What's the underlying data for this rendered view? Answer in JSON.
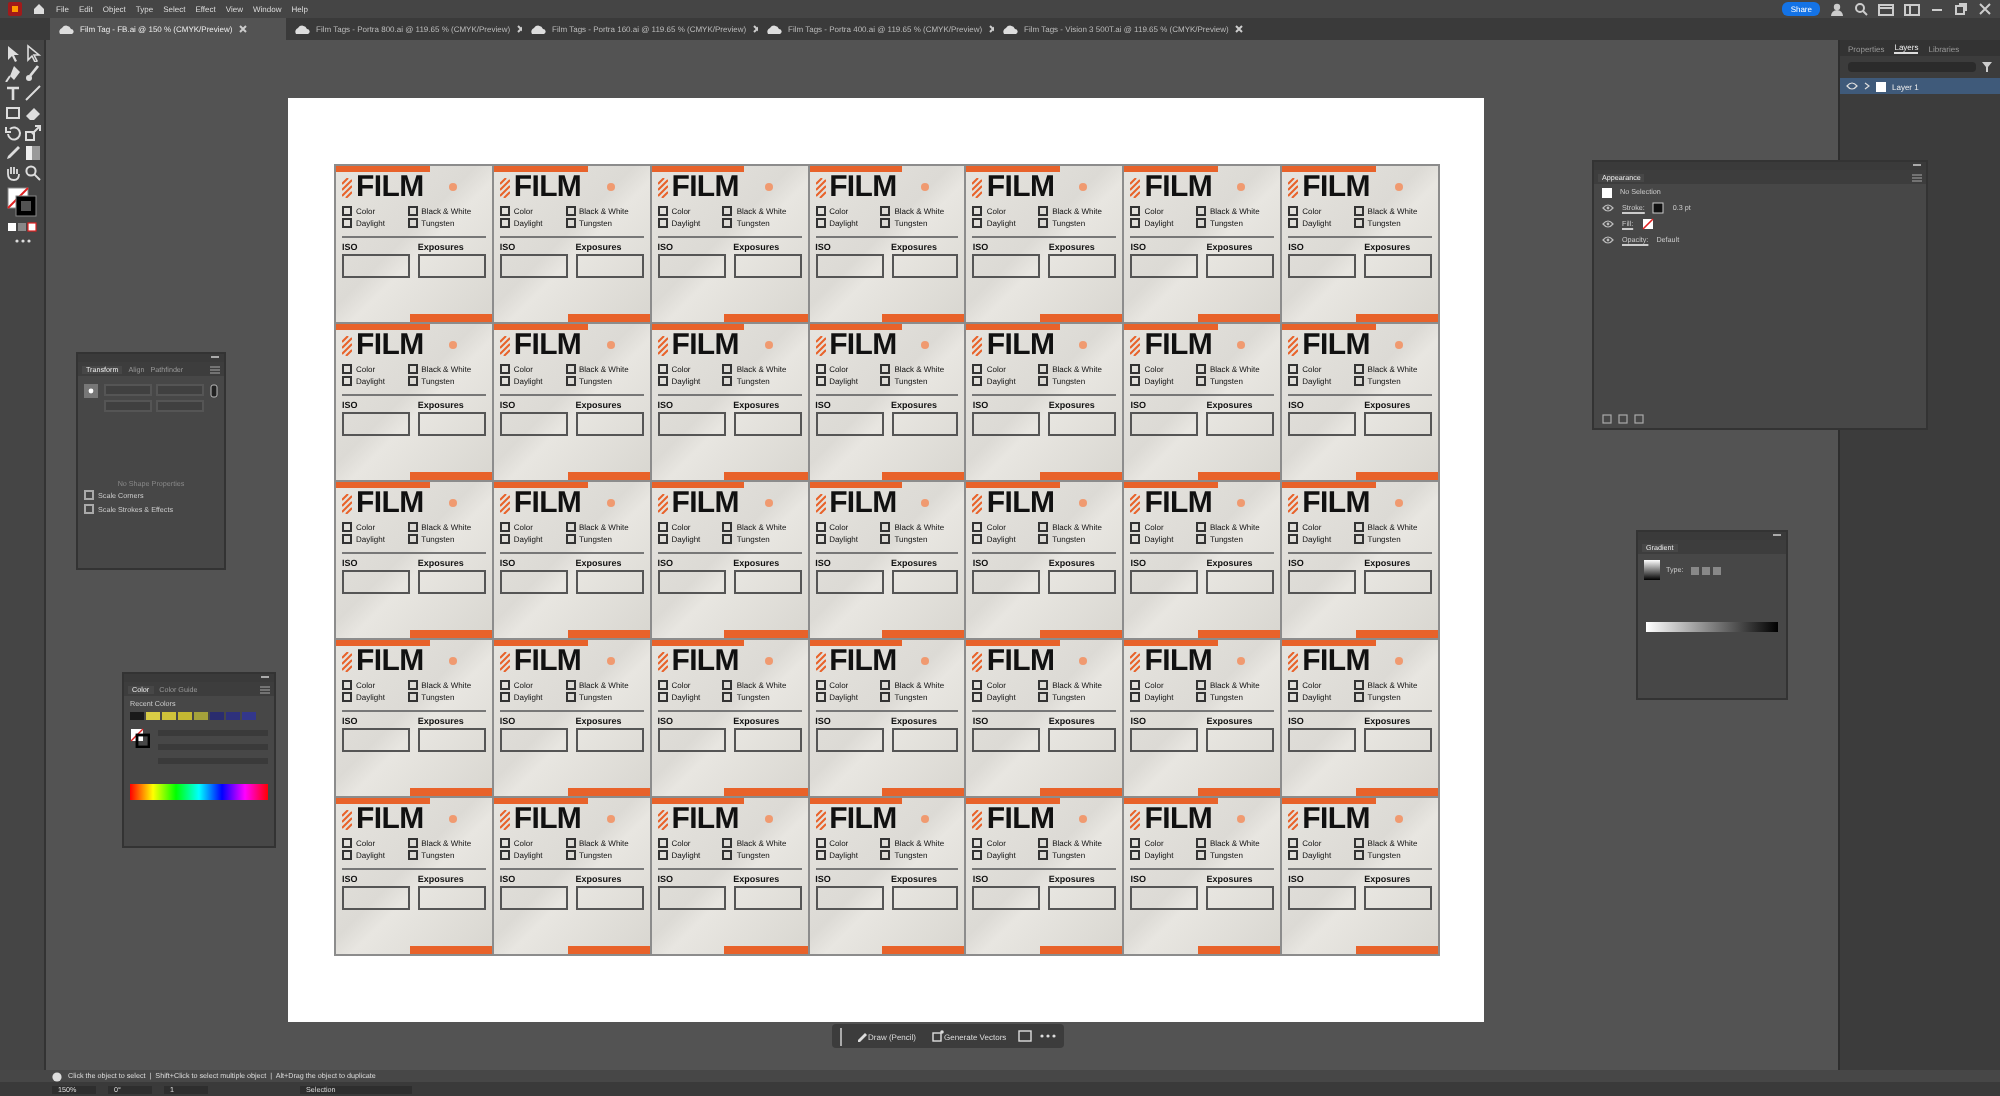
{
  "menu": [
    "File",
    "Edit",
    "Object",
    "Type",
    "Select",
    "Effect",
    "View",
    "Window",
    "Help"
  ],
  "share": "Share",
  "tabs": [
    {
      "label": "Film Tag - FB.ai @ 150 % (CMYK/Preview)",
      "selected": true
    },
    {
      "label": "Film Tags - Portra 800.ai @ 119.65 % (CMYK/Preview)",
      "selected": false
    },
    {
      "label": "Film Tags - Portra 160.ai @ 119.65 % (CMYK/Preview)",
      "selected": false
    },
    {
      "label": "Film Tags - Portra 400.ai @ 119.65 % (CMYK/Preview)",
      "selected": false
    },
    {
      "label": "Film Tags - Vision 3 500T.ai @ 119.65 % (CMYK/Preview)",
      "selected": false
    }
  ],
  "right_panel": {
    "tabs": [
      {
        "label": "Properties",
        "selected": false
      },
      {
        "label": "Layers",
        "selected": true
      },
      {
        "label": "Libraries",
        "selected": false
      }
    ],
    "layers": [
      {
        "name": "Layer 1",
        "selected": true
      }
    ]
  },
  "cards": [
    {
      "title": "FILM",
      "options": [
        {
          "label": "Color",
          "checked": false
        },
        {
          "label": "Black & White",
          "checked": false
        },
        {
          "label": "Daylight",
          "checked": false
        },
        {
          "label": "Tungsten",
          "checked": false
        }
      ],
      "fields": [
        "ISO",
        "Exposures"
      ]
    },
    {
      "title": "FILM",
      "options": [
        {
          "label": "Color",
          "checked": false
        },
        {
          "label": "Black & White",
          "checked": false
        },
        {
          "label": "Daylight",
          "checked": false
        },
        {
          "label": "Tungsten",
          "checked": false
        }
      ],
      "fields": [
        "ISO",
        "Exposures"
      ]
    },
    {
      "title": "FILM",
      "options": [
        {
          "label": "Color",
          "checked": false
        },
        {
          "label": "Black & White",
          "checked": false
        },
        {
          "label": "Daylight",
          "checked": false
        },
        {
          "label": "Tungsten",
          "checked": false
        }
      ],
      "fields": [
        "ISO",
        "Exposures"
      ]
    },
    {
      "title": "FILM",
      "options": [
        {
          "label": "Color",
          "checked": false
        },
        {
          "label": "Black & White",
          "checked": false
        },
        {
          "label": "Daylight",
          "checked": false
        },
        {
          "label": "Tungsten",
          "checked": false
        }
      ],
      "fields": [
        "ISO",
        "Exposures"
      ]
    },
    {
      "title": "FILM",
      "options": [
        {
          "label": "Color",
          "checked": false
        },
        {
          "label": "Black & White",
          "checked": false
        },
        {
          "label": "Daylight",
          "checked": false
        },
        {
          "label": "Tungsten",
          "checked": false
        }
      ],
      "fields": [
        "ISO",
        "Exposures"
      ]
    },
    {
      "title": "FILM",
      "options": [
        {
          "label": "Color",
          "checked": false
        },
        {
          "label": "Black & White",
          "checked": false
        },
        {
          "label": "Daylight",
          "checked": false
        },
        {
          "label": "Tungsten",
          "checked": false
        }
      ],
      "fields": [
        "ISO",
        "Exposures"
      ]
    },
    {
      "title": "FILM",
      "options": [
        {
          "label": "Color",
          "checked": false
        },
        {
          "label": "Black & White",
          "checked": false
        },
        {
          "label": "Daylight",
          "checked": false
        },
        {
          "label": "Tungsten",
          "checked": false
        }
      ],
      "fields": [
        "ISO",
        "Exposures"
      ]
    },
    {
      "title": "FILM",
      "options": [
        {
          "label": "Color",
          "checked": false
        },
        {
          "label": "Black & White",
          "checked": false
        },
        {
          "label": "Daylight",
          "checked": false
        },
        {
          "label": "Tungsten",
          "checked": false
        }
      ],
      "fields": [
        "ISO",
        "Exposures"
      ]
    },
    {
      "title": "FILM",
      "options": [
        {
          "label": "Color",
          "checked": false
        },
        {
          "label": "Black & White",
          "checked": false
        },
        {
          "label": "Daylight",
          "checked": false
        },
        {
          "label": "Tungsten",
          "checked": false
        }
      ],
      "fields": [
        "ISO",
        "Exposures"
      ]
    },
    {
      "title": "FILM",
      "options": [
        {
          "label": "Color",
          "checked": false
        },
        {
          "label": "Black & White",
          "checked": false
        },
        {
          "label": "Daylight",
          "checked": false
        },
        {
          "label": "Tungsten",
          "checked": false
        }
      ],
      "fields": [
        "ISO",
        "Exposures"
      ]
    },
    {
      "title": "FILM",
      "options": [
        {
          "label": "Color",
          "checked": false
        },
        {
          "label": "Black & White",
          "checked": false
        },
        {
          "label": "Daylight",
          "checked": false
        },
        {
          "label": "Tungsten",
          "checked": false
        }
      ],
      "fields": [
        "ISO",
        "Exposures"
      ]
    },
    {
      "title": "FILM",
      "options": [
        {
          "label": "Color",
          "checked": false
        },
        {
          "label": "Black & White",
          "checked": false
        },
        {
          "label": "Daylight",
          "checked": false
        },
        {
          "label": "Tungsten",
          "checked": false
        }
      ],
      "fields": [
        "ISO",
        "Exposures"
      ]
    },
    {
      "title": "FILM",
      "options": [
        {
          "label": "Color",
          "checked": false
        },
        {
          "label": "Black & White",
          "checked": false
        },
        {
          "label": "Daylight",
          "checked": false
        },
        {
          "label": "Tungsten",
          "checked": false
        }
      ],
      "fields": [
        "ISO",
        "Exposures"
      ]
    },
    {
      "title": "FILM",
      "options": [
        {
          "label": "Color",
          "checked": false
        },
        {
          "label": "Black & White",
          "checked": false
        },
        {
          "label": "Daylight",
          "checked": false
        },
        {
          "label": "Tungsten",
          "checked": false
        }
      ],
      "fields": [
        "ISO",
        "Exposures"
      ]
    },
    {
      "title": "FILM",
      "options": [
        {
          "label": "Color",
          "checked": false
        },
        {
          "label": "Black & White",
          "checked": false
        },
        {
          "label": "Daylight",
          "checked": false
        },
        {
          "label": "Tungsten",
          "checked": false
        }
      ],
      "fields": [
        "ISO",
        "Exposures"
      ]
    },
    {
      "title": "FILM",
      "options": [
        {
          "label": "Color",
          "checked": false
        },
        {
          "label": "Black & White",
          "checked": false
        },
        {
          "label": "Daylight",
          "checked": false
        },
        {
          "label": "Tungsten",
          "checked": false
        }
      ],
      "fields": [
        "ISO",
        "Exposures"
      ]
    },
    {
      "title": "FILM",
      "options": [
        {
          "label": "Color",
          "checked": false
        },
        {
          "label": "Black & White",
          "checked": false
        },
        {
          "label": "Daylight",
          "checked": false
        },
        {
          "label": "Tungsten",
          "checked": false
        }
      ],
      "fields": [
        "ISO",
        "Exposures"
      ]
    },
    {
      "title": "FILM",
      "options": [
        {
          "label": "Color",
          "checked": false
        },
        {
          "label": "Black & White",
          "checked": false
        },
        {
          "label": "Daylight",
          "checked": false
        },
        {
          "label": "Tungsten",
          "checked": false
        }
      ],
      "fields": [
        "ISO",
        "Exposures"
      ]
    },
    {
      "title": "FILM",
      "options": [
        {
          "label": "Color",
          "checked": false
        },
        {
          "label": "Black & White",
          "checked": false
        },
        {
          "label": "Daylight",
          "checked": false
        },
        {
          "label": "Tungsten",
          "checked": false
        }
      ],
      "fields": [
        "ISO",
        "Exposures"
      ]
    },
    {
      "title": "FILM",
      "options": [
        {
          "label": "Color",
          "checked": false
        },
        {
          "label": "Black & White",
          "checked": false
        },
        {
          "label": "Daylight",
          "checked": false
        },
        {
          "label": "Tungsten",
          "checked": false
        }
      ],
      "fields": [
        "ISO",
        "Exposures"
      ]
    },
    {
      "title": "FILM",
      "options": [
        {
          "label": "Color",
          "checked": false
        },
        {
          "label": "Black & White",
          "checked": false
        },
        {
          "label": "Daylight",
          "checked": false
        },
        {
          "label": "Tungsten",
          "checked": false
        }
      ],
      "fields": [
        "ISO",
        "Exposures"
      ]
    },
    {
      "title": "FILM",
      "options": [
        {
          "label": "Color",
          "checked": false
        },
        {
          "label": "Black & White",
          "checked": false
        },
        {
          "label": "Daylight",
          "checked": false
        },
        {
          "label": "Tungsten",
          "checked": false
        }
      ],
      "fields": [
        "ISO",
        "Exposures"
      ]
    },
    {
      "title": "FILM",
      "options": [
        {
          "label": "Color",
          "checked": false
        },
        {
          "label": "Black & White",
          "checked": false
        },
        {
          "label": "Daylight",
          "checked": false
        },
        {
          "label": "Tungsten",
          "checked": false
        }
      ],
      "fields": [
        "ISO",
        "Exposures"
      ]
    },
    {
      "title": "FILM",
      "options": [
        {
          "label": "Color",
          "checked": false
        },
        {
          "label": "Black & White",
          "checked": false
        },
        {
          "label": "Daylight",
          "checked": false
        },
        {
          "label": "Tungsten",
          "checked": false
        }
      ],
      "fields": [
        "ISO",
        "Exposures"
      ]
    },
    {
      "title": "FILM",
      "options": [
        {
          "label": "Color",
          "checked": false
        },
        {
          "label": "Black & White",
          "checked": false
        },
        {
          "label": "Daylight",
          "checked": false
        },
        {
          "label": "Tungsten",
          "checked": false
        }
      ],
      "fields": [
        "ISO",
        "Exposures"
      ]
    },
    {
      "title": "FILM",
      "options": [
        {
          "label": "Color",
          "checked": false
        },
        {
          "label": "Black & White",
          "checked": false
        },
        {
          "label": "Daylight",
          "checked": false
        },
        {
          "label": "Tungsten",
          "checked": false
        }
      ],
      "fields": [
        "ISO",
        "Exposures"
      ]
    },
    {
      "title": "FILM",
      "options": [
        {
          "label": "Color",
          "checked": false
        },
        {
          "label": "Black & White",
          "checked": false
        },
        {
          "label": "Daylight",
          "checked": false
        },
        {
          "label": "Tungsten",
          "checked": false
        }
      ],
      "fields": [
        "ISO",
        "Exposures"
      ]
    },
    {
      "title": "FILM",
      "options": [
        {
          "label": "Color",
          "checked": false
        },
        {
          "label": "Black & White",
          "checked": false
        },
        {
          "label": "Daylight",
          "checked": false
        },
        {
          "label": "Tungsten",
          "checked": false
        }
      ],
      "fields": [
        "ISO",
        "Exposures"
      ]
    },
    {
      "title": "FILM",
      "options": [
        {
          "label": "Color",
          "checked": false
        },
        {
          "label": "Black & White",
          "checked": false
        },
        {
          "label": "Daylight",
          "checked": false
        },
        {
          "label": "Tungsten",
          "checked": false
        }
      ],
      "fields": [
        "ISO",
        "Exposures"
      ]
    },
    {
      "title": "FILM",
      "options": [
        {
          "label": "Color",
          "checked": false
        },
        {
          "label": "Black & White",
          "checked": false
        },
        {
          "label": "Daylight",
          "checked": false
        },
        {
          "label": "Tungsten",
          "checked": false
        }
      ],
      "fields": [
        "ISO",
        "Exposures"
      ]
    },
    {
      "title": "FILM",
      "options": [
        {
          "label": "Color",
          "checked": false
        },
        {
          "label": "Black & White",
          "checked": false
        },
        {
          "label": "Daylight",
          "checked": false
        },
        {
          "label": "Tungsten",
          "checked": false
        }
      ],
      "fields": [
        "ISO",
        "Exposures"
      ]
    },
    {
      "title": "FILM",
      "options": [
        {
          "label": "Color",
          "checked": false
        },
        {
          "label": "Black & White",
          "checked": false
        },
        {
          "label": "Daylight",
          "checked": false
        },
        {
          "label": "Tungsten",
          "checked": false
        }
      ],
      "fields": [
        "ISO",
        "Exposures"
      ]
    },
    {
      "title": "FILM",
      "options": [
        {
          "label": "Color",
          "checked": false
        },
        {
          "label": "Black & White",
          "checked": false
        },
        {
          "label": "Daylight",
          "checked": false
        },
        {
          "label": "Tungsten",
          "checked": false
        }
      ],
      "fields": [
        "ISO",
        "Exposures"
      ]
    },
    {
      "title": "FILM",
      "options": [
        {
          "label": "Color",
          "checked": false
        },
        {
          "label": "Black & White",
          "checked": false
        },
        {
          "label": "Daylight",
          "checked": false
        },
        {
          "label": "Tungsten",
          "checked": false
        }
      ],
      "fields": [
        "ISO",
        "Exposures"
      ]
    },
    {
      "title": "FILM",
      "options": [
        {
          "label": "Color",
          "checked": false
        },
        {
          "label": "Black & White",
          "checked": false
        },
        {
          "label": "Daylight",
          "checked": false
        },
        {
          "label": "Tungsten",
          "checked": false
        }
      ],
      "fields": [
        "ISO",
        "Exposures"
      ]
    }
  ],
  "transform_panel": {
    "tabs": [
      {
        "label": "Transform",
        "selected": true
      },
      {
        "label": "Align",
        "selected": false
      },
      {
        "label": "Pathfinder",
        "selected": false
      }
    ],
    "message": "No Shape Properties",
    "options": [
      {
        "label": "Scale Corners",
        "checked": false
      },
      {
        "label": "Scale Strokes & Effects",
        "checked": false
      }
    ]
  },
  "color_panel": {
    "tabs": [
      {
        "label": "Color",
        "selected": true
      },
      {
        "label": "Color Guide",
        "selected": false
      }
    ],
    "recent_label": "Recent Colors",
    "swatches": [
      {
        "color": "#1a1a1a"
      },
      {
        "color": "#d8cc45"
      },
      {
        "color": "#cfc23a"
      },
      {
        "color": "#c4b832"
      },
      {
        "color": "#a5a23a"
      },
      {
        "color": "#2a2c6e"
      },
      {
        "color": "#2e317c"
      },
      {
        "color": "#33378c"
      }
    ]
  },
  "appearance_panel": {
    "title": "Appearance",
    "selection": "No Selection",
    "rows": [
      {
        "kind": "stroke",
        "label": "Stroke:",
        "value": "0.3 pt"
      },
      {
        "kind": "fill",
        "label": "Fill:"
      },
      {
        "kind": "opacity",
        "label": "Opacity:",
        "value": "Default"
      }
    ]
  },
  "gradient_panel": {
    "title": "Gradient",
    "type_label": "Type:"
  },
  "contextual_bar": {
    "actions": [
      "Draw (Pencil)",
      "Generate Vectors"
    ]
  },
  "hint": "Click the object to select  |  Shift+Click to select multiple object  |  Alt+Drag the object to duplicate",
  "status_bar": {
    "zoom": "150%",
    "rotation": "0°",
    "artboard": "1",
    "tool": "Selection"
  }
}
